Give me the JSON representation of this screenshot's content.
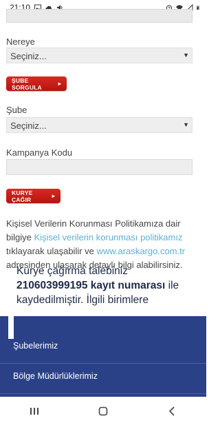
{
  "status_bar": {
    "time": "21:10",
    "icons_left": [
      "image-icon",
      "cloud-icon",
      "volume-icon"
    ],
    "icons_right": [
      "alarm-icon",
      "wifi-icon",
      "signal-icon",
      "battery-icon"
    ]
  },
  "form": {
    "nereye_label": "Nereye",
    "nereye_select": "Seçiniz...",
    "sube_sorgula_btn": "ŞUBE SORGULA",
    "sube_label": "Şube",
    "sube_select": "Seçiniz...",
    "kampanya_label": "Kampanya Kodu",
    "kampanya_value": "",
    "kurye_btn": "KURYE ÇAĞIR"
  },
  "privacy": {
    "text1": "Kişisel Verilerin Korunması Politikamıza dair bilgiye ",
    "link1": "Kişisel verilerin korunması politikamız",
    "text2": " tıklayarak ulaşabilir ve ",
    "link2": "www.araskargo.com.tr",
    "text3": " adresinden ulaşarak detaylı bilgi alabilirsiniz."
  },
  "notice": {
    "line_start": "Kurye çağırma talebiniz",
    "record_number": "210603999195 kayıt numarası",
    "after": " ile",
    "line3": "kaydedilmiştir. İlgili birimlere"
  },
  "nav_menu": {
    "item1": "Şubelerimiz",
    "item2": "Bölge Müdürlüklerimiz"
  },
  "accent_colors": {
    "button_red": "#c41f18",
    "nav_blue": "#2a4187",
    "link_blue": "#5bb0d8"
  }
}
